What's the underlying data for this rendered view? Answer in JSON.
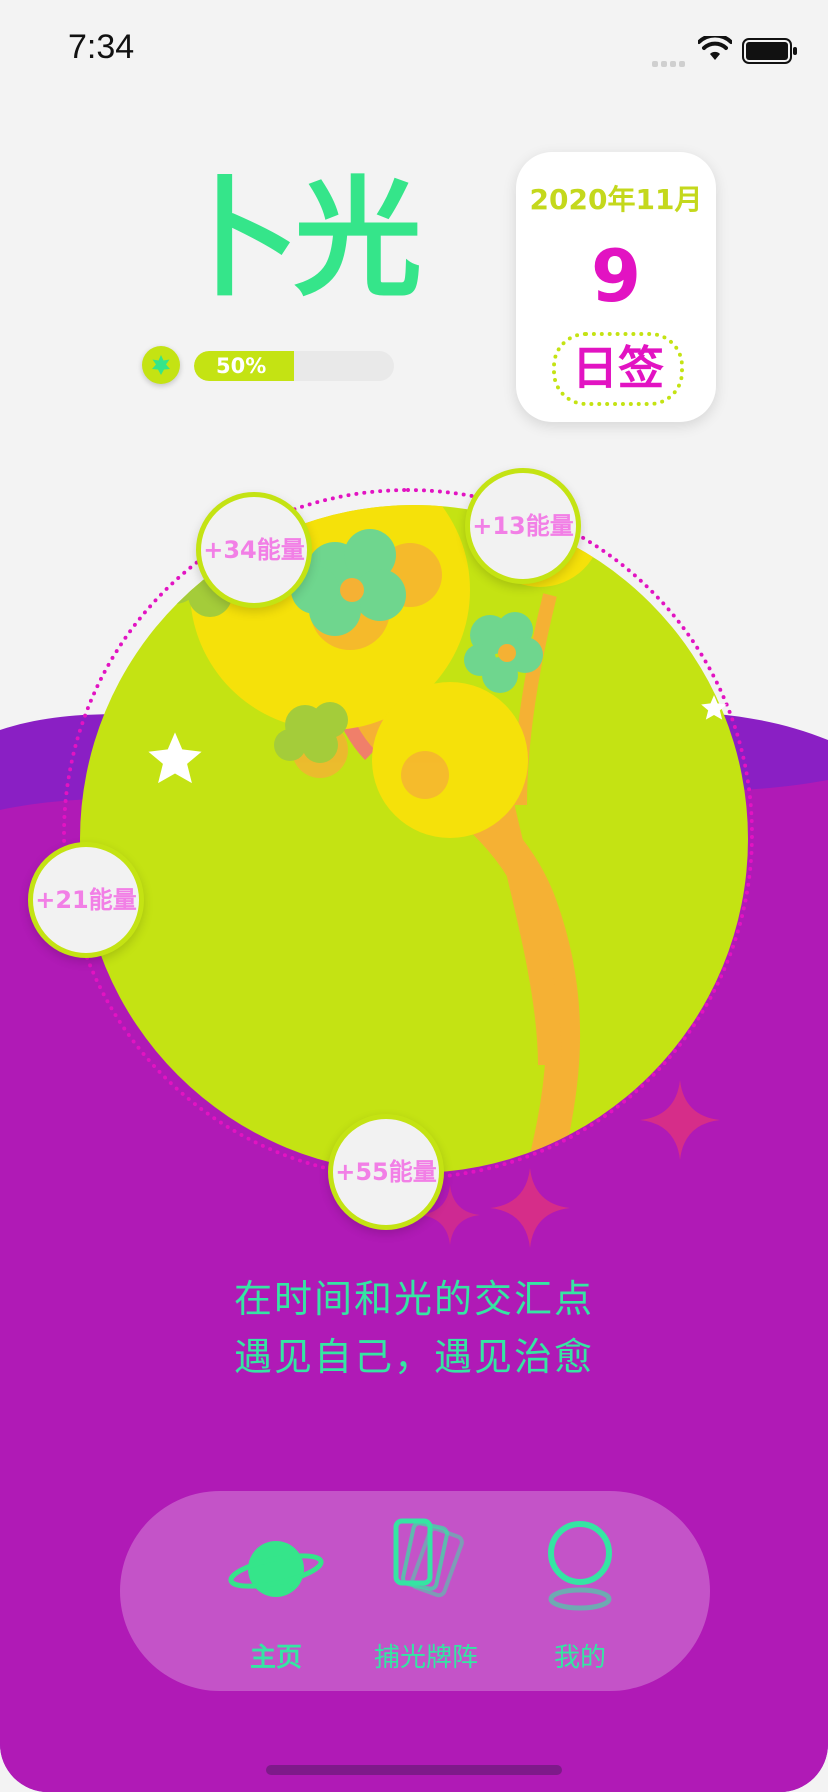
{
  "status_bar": {
    "time": "7:34"
  },
  "app": {
    "logo": "卜光"
  },
  "energy": {
    "progress": 50,
    "progress_label": "50%"
  },
  "calendar": {
    "month": "2020年11月",
    "day": "9",
    "sign_label": "日签"
  },
  "bubbles": [
    {
      "label": "+34能量"
    },
    {
      "label": "+13能量"
    },
    {
      "label": "+21能量"
    },
    {
      "label": "+55能量"
    }
  ],
  "slogan": {
    "line1": "在时间和光的交汇点",
    "line2": "遇见自己，遇见治愈"
  },
  "tabs": [
    {
      "label": "主页",
      "icon": "planet-icon",
      "active": true
    },
    {
      "label": "捕光牌阵",
      "icon": "cards-icon",
      "active": false
    },
    {
      "label": "我的",
      "icon": "profile-ring-icon",
      "active": false
    }
  ],
  "colors": {
    "background": "#f3f3f3",
    "purple": "#b01ab6",
    "accent_green": "#35e58a",
    "lime": "#c4e313",
    "magenta": "#e213c2"
  }
}
